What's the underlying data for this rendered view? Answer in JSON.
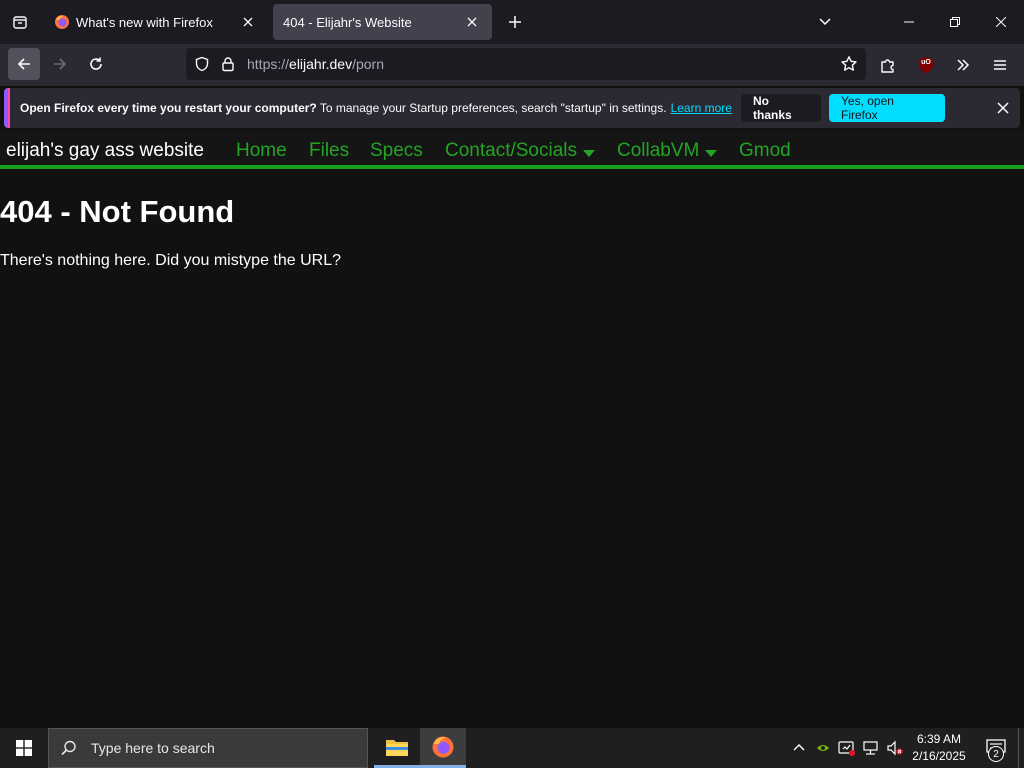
{
  "browser": {
    "tabs": [
      {
        "title": "What's new with Firefox",
        "active": false
      },
      {
        "title": "404 - Elijahr's Website",
        "active": true
      }
    ],
    "url": {
      "prefix": "https://",
      "domain": "elijahr.dev",
      "path": "/porn"
    },
    "ublock_label": "uO"
  },
  "notification": {
    "bold": "Open Firefox every time you restart your computer?",
    "text": " To manage your Startup preferences, search \"startup\" in settings.",
    "link": "Learn more",
    "no_button": "No thanks",
    "yes_button": "Yes, open Firefox"
  },
  "site": {
    "title": "elijah's gay ass website",
    "nav": [
      "Home",
      "Files",
      "Specs",
      "Contact/Socials",
      "CollabVM",
      "Gmod"
    ],
    "heading": "404 - Not Found",
    "message": "There's nothing here. Did you mistype the URL?"
  },
  "taskbar": {
    "search_placeholder": "Type here to search",
    "time": "6:39 AM",
    "date": "2/16/2025",
    "notification_count": "2"
  },
  "colors": {
    "site_green": "#23a523",
    "accent_cyan": "#00ddff",
    "tab_active": "#42414d"
  }
}
